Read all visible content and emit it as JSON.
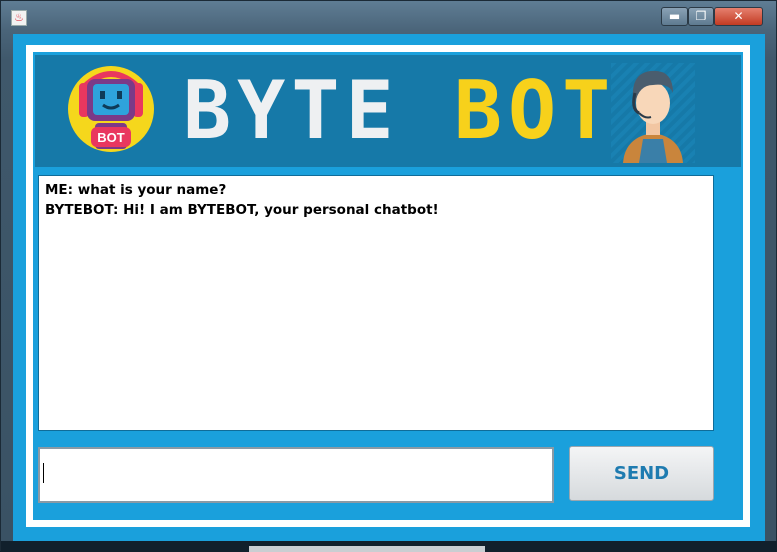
{
  "window": {
    "controls": {
      "minimize": "▬",
      "maximize": "❐",
      "close": "✕"
    },
    "app_icon": "java-cup-icon"
  },
  "banner": {
    "title_word1": "BYTE",
    "title_word2": "BOT",
    "robot_badge": "BOT",
    "colors": {
      "banner_bg": "#1679a8",
      "title_white": "#eef0f2",
      "title_yellow": "#f7d11b"
    }
  },
  "chat": {
    "lines": [
      "ME: what is your name?",
      "BYTEBOT: Hi! I am BYTEBOT, your personal chatbot!"
    ]
  },
  "input": {
    "value": "",
    "placeholder": ""
  },
  "send_button": {
    "label": "SEND"
  },
  "colors": {
    "accent": "#1aa0dc",
    "frame": "#ffffff",
    "send_text": "#1e7bb0"
  }
}
